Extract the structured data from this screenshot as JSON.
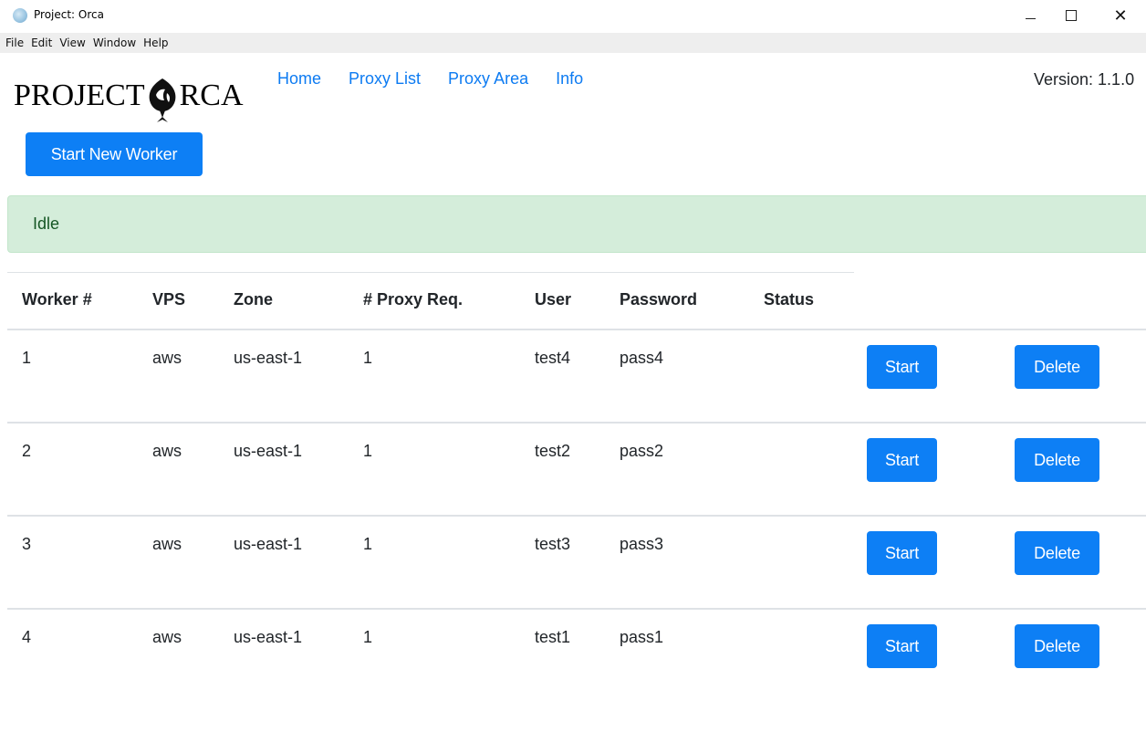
{
  "window": {
    "title": "Project: Orca",
    "icon": "orca-app-icon"
  },
  "menu": [
    {
      "label": "File"
    },
    {
      "label": "Edit"
    },
    {
      "label": "View"
    },
    {
      "label": "Window"
    },
    {
      "label": "Help"
    }
  ],
  "logo": {
    "text_left": "PROJECT",
    "text_right": "RCA",
    "icon": "orca-logo-icon"
  },
  "nav": [
    {
      "label": "Home"
    },
    {
      "label": "Proxy List"
    },
    {
      "label": "Proxy Area"
    },
    {
      "label": "Info"
    }
  ],
  "version": "Version: 1.1.0",
  "actions": {
    "start_new_worker": "Start New Worker"
  },
  "status_alert": "Idle",
  "table": {
    "headers": [
      "Worker #",
      "VPS",
      "Zone",
      "# Proxy Req.",
      "User",
      "Password",
      "Status"
    ],
    "rows": [
      {
        "worker": "1",
        "vps": "aws",
        "zone": "us-east-1",
        "proxy_req": "1",
        "user": "test4",
        "password": "pass4",
        "status": "",
        "start": "Start",
        "delete": "Delete"
      },
      {
        "worker": "2",
        "vps": "aws",
        "zone": "us-east-1",
        "proxy_req": "1",
        "user": "test2",
        "password": "pass2",
        "status": "",
        "start": "Start",
        "delete": "Delete"
      },
      {
        "worker": "3",
        "vps": "aws",
        "zone": "us-east-1",
        "proxy_req": "1",
        "user": "test3",
        "password": "pass3",
        "status": "",
        "start": "Start",
        "delete": "Delete"
      },
      {
        "worker": "4",
        "vps": "aws",
        "zone": "us-east-1",
        "proxy_req": "1",
        "user": "test1",
        "password": "pass1",
        "status": "",
        "start": "Start",
        "delete": "Delete"
      }
    ]
  },
  "colors": {
    "primary": "#0d7ff5",
    "link": "#0d7bf2",
    "alert_bg": "#d4edda",
    "alert_text": "#155724"
  }
}
